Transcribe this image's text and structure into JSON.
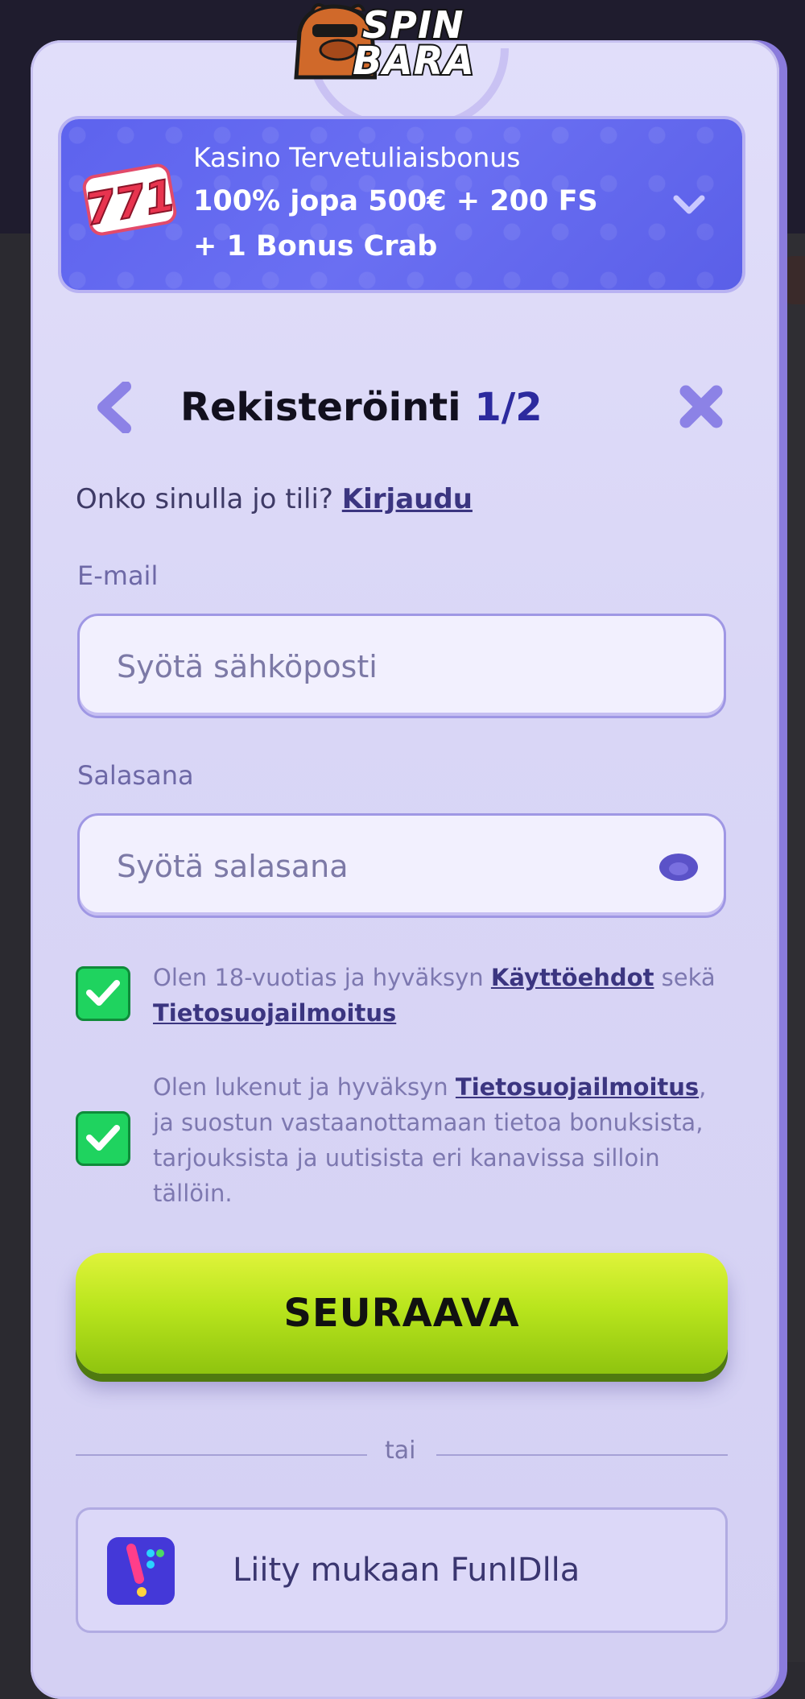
{
  "brand": {
    "logo_line1": "SPIN",
    "logo_line2": "BARA"
  },
  "bonus": {
    "title": "Kasino Tervetuliaisbonus",
    "line2": "100% jopa 500€ + 200 FS",
    "line3": "+ 1 Bonus Crab",
    "icon_text": "771"
  },
  "header": {
    "title": "Rekisteröinti",
    "step": "1/2"
  },
  "login_prompt": {
    "question": "Onko sinulla jo tili?",
    "link": "Kirjaudu"
  },
  "email": {
    "label": "E-mail",
    "placeholder": "Syötä sähköposti",
    "value": ""
  },
  "password": {
    "label": "Salasana",
    "placeholder": "Syötä salasana",
    "value": ""
  },
  "consents": [
    {
      "checked": true,
      "text_before": "Olen 18-vuotias ja hyväksyn ",
      "link1": "Käyttöehdot",
      "text_middle": " sekä ",
      "link2": "Tietosuojailmoitus",
      "text_after": ""
    },
    {
      "checked": true,
      "text_before": "Olen lukenut ja hyväksyn ",
      "link1": "Tietosuojailmoitus",
      "text_after": ", ja suostun vastaanottamaan tietoa bonuksista, tarjouksista ja uutisista eri kanavissa silloin tällöin."
    }
  ],
  "next_button": "SEURAAVA",
  "divider": "tai",
  "funid_button": "Liity mukaan FunIDlla",
  "colors": {
    "accent_blue": "#5d63ee",
    "check_green": "#1fd35f",
    "cta_green": "#b9e51d",
    "modal_bg": "#dcd9f8"
  }
}
